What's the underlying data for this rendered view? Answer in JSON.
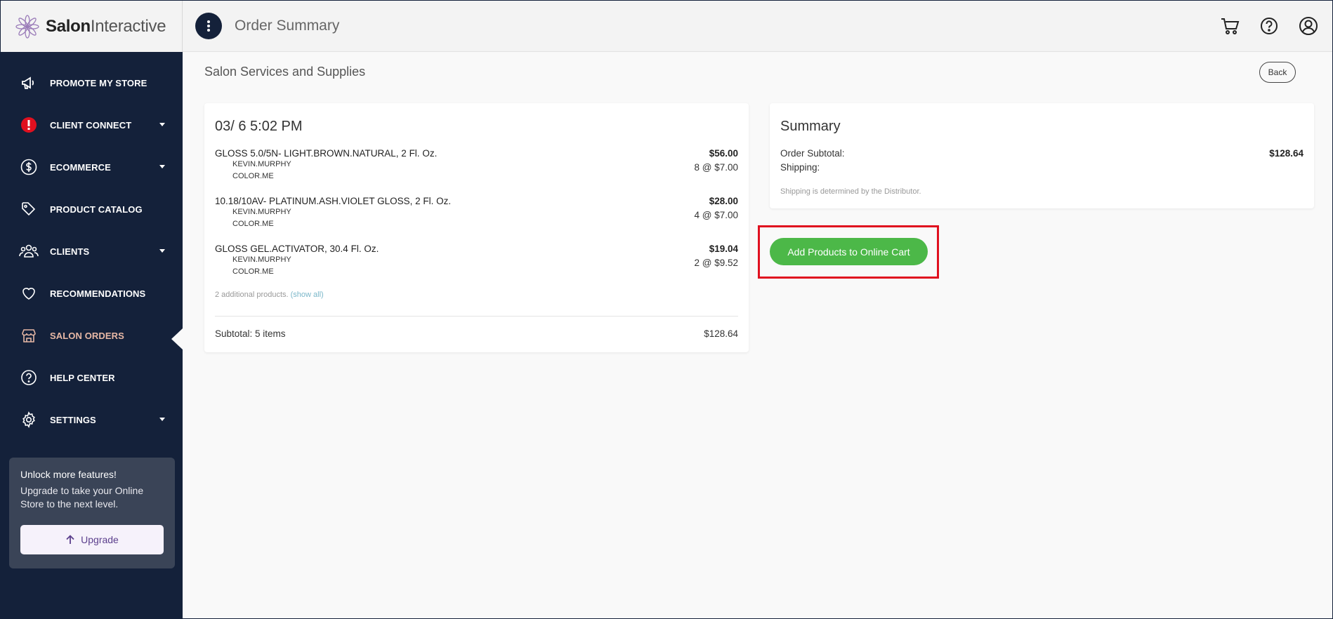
{
  "brand": {
    "name_bold": "Salon",
    "name_rest": "Interactive"
  },
  "header": {
    "title": "Order Summary",
    "icons": [
      "menu-icon",
      "cart-icon",
      "help-icon",
      "account-icon"
    ]
  },
  "sidebar": {
    "items": [
      {
        "label": "PROMOTE MY STORE",
        "icon": "megaphone-icon",
        "caret": false
      },
      {
        "label": "CLIENT CONNECT",
        "icon": "alert-icon",
        "caret": true
      },
      {
        "label": "ECOMMERCE",
        "icon": "dollar-icon",
        "caret": true
      },
      {
        "label": "PRODUCT CATALOG",
        "icon": "tag-icon",
        "caret": false
      },
      {
        "label": "CLIENTS",
        "icon": "people-icon",
        "caret": true
      },
      {
        "label": "RECOMMENDATIONS",
        "icon": "heart-icon",
        "caret": false
      },
      {
        "label": "SALON ORDERS",
        "icon": "store-icon",
        "caret": false,
        "active": true
      },
      {
        "label": "HELP CENTER",
        "icon": "help-circle-icon",
        "caret": false
      },
      {
        "label": "SETTINGS",
        "icon": "gear-icon",
        "caret": true
      }
    ],
    "upgrade": {
      "title": "Unlock more features!",
      "text": "Upgrade to take your Online Store to the next level.",
      "button": "Upgrade"
    }
  },
  "main": {
    "section_title": "Salon Services and Supplies",
    "back_label": "Back",
    "order": {
      "date": "03/ 6 5:02 PM",
      "items": [
        {
          "name": "GLOSS 5.0/5N- LIGHT.BROWN.NATURAL, 2 Fl. Oz.",
          "brand1": "KEVIN.MURPHY",
          "brand2": "COLOR.ME",
          "price": "$56.00",
          "qty": "8 @ $7.00"
        },
        {
          "name": "10.18/10AV- PLATINUM.ASH.VIOLET GLOSS, 2 Fl. Oz.",
          "brand1": "KEVIN.MURPHY",
          "brand2": "COLOR.ME",
          "price": "$28.00",
          "qty": "4 @ $7.00"
        },
        {
          "name": "GLOSS GEL.ACTIVATOR, 30.4 Fl. Oz.",
          "brand1": "KEVIN.MURPHY",
          "brand2": "COLOR.ME",
          "price": "$19.04",
          "qty": "2 @ $9.52"
        }
      ],
      "more_text": "2 additional products.",
      "show_all": "(show all)",
      "subtotal_label": "Subtotal: 5 items",
      "subtotal_value": "$128.64"
    },
    "summary": {
      "title": "Summary",
      "order_subtotal_label": "Order Subtotal:",
      "order_subtotal_value": "$128.64",
      "shipping_label": "Shipping:",
      "shipping_note": "Shipping is determined by the Distributor."
    },
    "add_button": "Add Products to Online Cart"
  },
  "colors": {
    "sidebar": "#14213a",
    "accent_green": "#4cb848",
    "highlight": "#e0101f",
    "active_nav": "#e7b8a5"
  }
}
